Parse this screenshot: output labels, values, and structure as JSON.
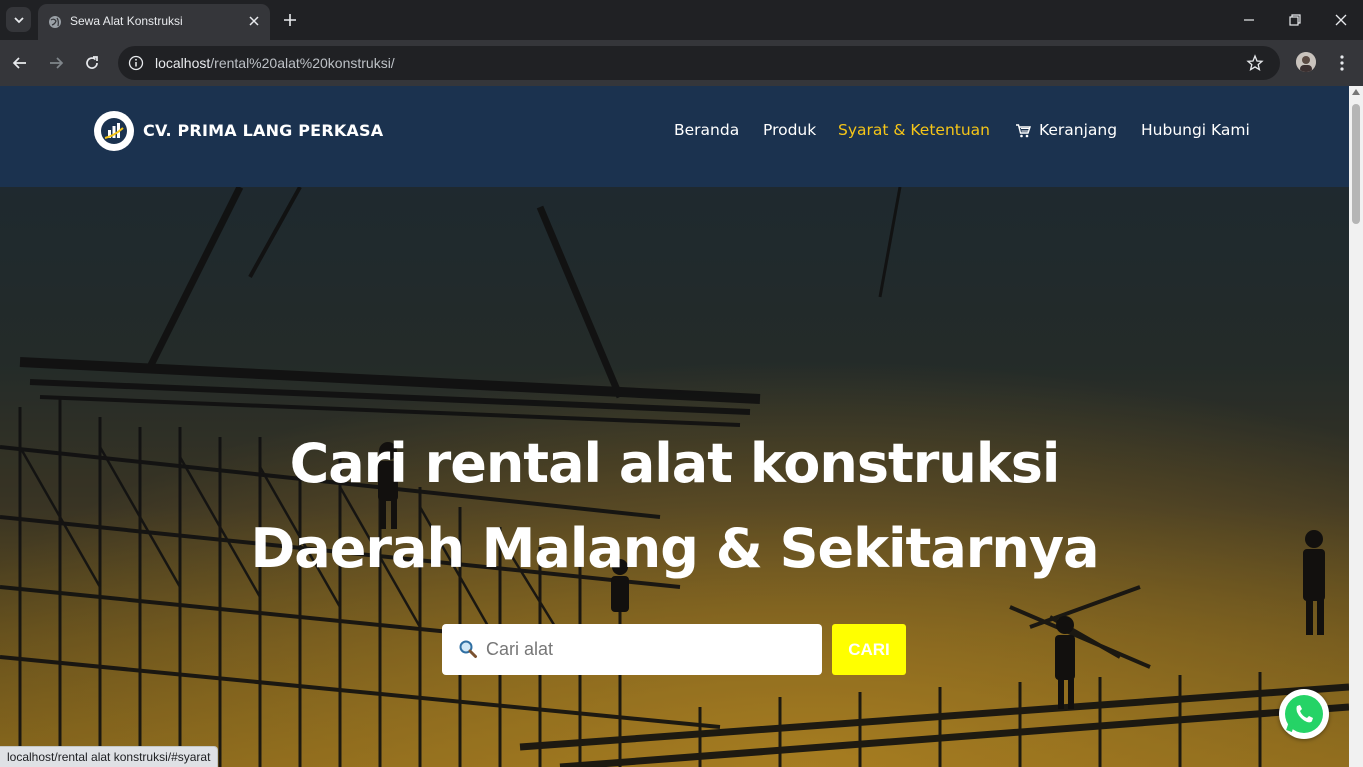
{
  "browser": {
    "tab_title": "Sewa Alat Konstruksi",
    "url_host": "localhost",
    "url_path": "/rental%20alat%20konstruksi/",
    "status_url": "localhost/rental alat konstruksi/#syarat",
    "icons": [
      "tab-search-icon",
      "globe-icon",
      "close-icon",
      "plus-icon",
      "minimize-icon",
      "restore-icon",
      "close-window-icon",
      "back-arrow-icon",
      "forward-arrow-icon",
      "reload-icon",
      "info-icon",
      "star-icon",
      "avatar",
      "kebab-menu-icon"
    ]
  },
  "site": {
    "brand": "CV. PRIMA LANG PERKASA",
    "nav": {
      "home": "Beranda",
      "products": "Produk",
      "terms": "Syarat & Ketentuan",
      "cart": "Keranjang",
      "contact": "Hubungi Kami"
    },
    "active_nav_color": "#f5c518",
    "header_color": "#1b324f"
  },
  "hero": {
    "title_line1": "Cari rental alat konstruksi",
    "title_line2": "Daerah Malang & Sekitarnya",
    "search_placeholder": "Cari alat",
    "search_button": "CARI",
    "search_button_color": "#ffff00"
  },
  "floating": {
    "icon": "whatsapp-icon",
    "color": "#25d366"
  }
}
